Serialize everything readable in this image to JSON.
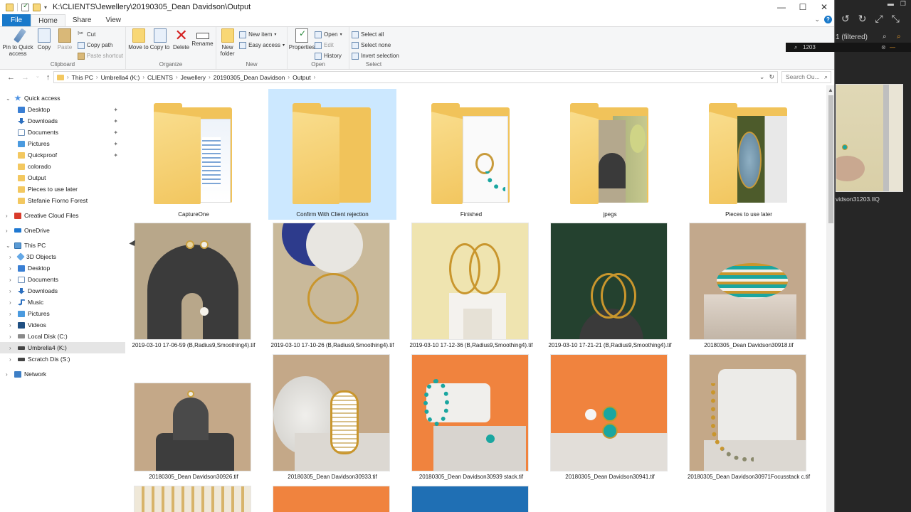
{
  "window": {
    "title": "K:\\CLIENTS\\Jewellery\\20190305_Dean Davidson\\Output",
    "controls": {
      "minimize": "—",
      "maximize": "☐",
      "close": "✕"
    }
  },
  "ribbon_tabs": [
    "File",
    "Home",
    "Share",
    "View"
  ],
  "ribbon": {
    "clipboard": {
      "label": "Clipboard",
      "pin": "Pin to Quick access",
      "copy": "Copy",
      "paste": "Paste",
      "cut": "Cut",
      "copy_path": "Copy path",
      "paste_shortcut": "Paste shortcut"
    },
    "organize": {
      "label": "Organize",
      "move_to": "Move to",
      "copy_to": "Copy to",
      "delete": "Delete",
      "rename": "Rename"
    },
    "new": {
      "label": "New",
      "new_folder": "New folder",
      "new_item": "New item",
      "easy_access": "Easy access"
    },
    "open": {
      "label": "Open",
      "properties": "Properties",
      "open": "Open",
      "edit": "Edit",
      "history": "History"
    },
    "select": {
      "label": "Select",
      "select_all": "Select all",
      "select_none": "Select none",
      "invert": "Invert selection"
    }
  },
  "address": {
    "crumbs": [
      "This PC",
      "Umbrella4 (K:)",
      "CLIENTS",
      "Jewellery",
      "20190305_Dean Davidson",
      "Output"
    ],
    "search_placeholder": "Search Ou..."
  },
  "nav": {
    "quick_access": "Quick access",
    "quick_items": [
      "Desktop",
      "Downloads",
      "Documents",
      "Pictures",
      "Quickproof",
      "colorado",
      "Output",
      "Pieces to use later",
      "Stefanie Fiorno Forest"
    ],
    "creative_cloud": "Creative Cloud Files",
    "onedrive": "OneDrive",
    "this_pc": "This PC",
    "pc_items": [
      "3D Objects",
      "Desktop",
      "Documents",
      "Downloads",
      "Music",
      "Pictures",
      "Videos",
      "Local Disk (C:)",
      "Umbrella4 (K:)",
      "Scratch Dis (S:)"
    ],
    "network": "Network"
  },
  "folders": [
    {
      "name": "CaptureOne"
    },
    {
      "name": "Confirm With Client rejection"
    },
    {
      "name": "Finished"
    },
    {
      "name": "jpegs"
    },
    {
      "name": "Pieces to use later"
    }
  ],
  "files_row1": [
    "2019-03-10 17-06-59 (B,Radius9,Smoothing4).tif",
    "2019-03-10 17-10-26 (B,Radius9,Smoothing4).tif",
    "2019-03-10 17-12-36 (B,Radius9,Smoothing4).tif",
    "2019-03-10 17-21-21 (B,Radius9,Smoothing4).tif",
    "20180305_Dean Davidson30918.tif"
  ],
  "files_row2": [
    "20180305_Dean Davidson30926.tif",
    "20180305_Dean Davidson30933.tif",
    "20180305_Dean Davidson30939 stack.tif",
    "20180305_Dean Davidson30941.tif",
    "20180305_Dean Davidson30971Focusstack c.tif"
  ],
  "right_app": {
    "filter_label": "1 (filtered)",
    "search_value": "1203",
    "thumb_name": "vidson31203.IIQ"
  }
}
